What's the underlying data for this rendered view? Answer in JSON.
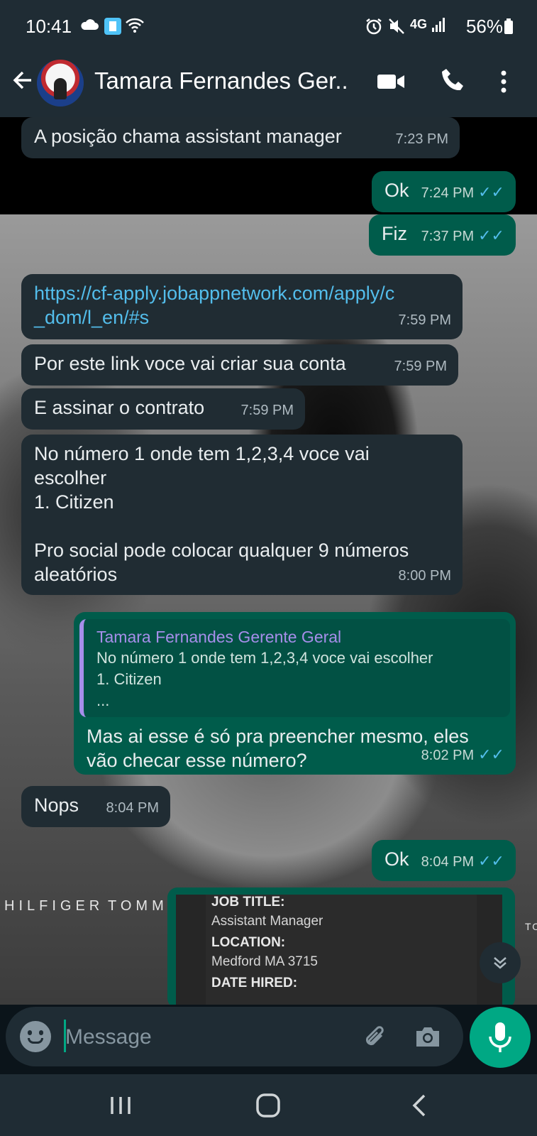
{
  "status_bar": {
    "time": "10:41",
    "network": "4G",
    "battery": "56%"
  },
  "header": {
    "contact_name": "Tamara Fernandes Ger...",
    "icons": [
      "back-arrow-icon",
      "avatar",
      "video-call-icon",
      "phone-icon",
      "more-options-icon"
    ]
  },
  "messages": [
    {
      "dir": "in",
      "text": "A posição chama assistant manager",
      "time": "7:23 PM"
    },
    {
      "dir": "out",
      "text": "Ok",
      "time": "7:24 PM",
      "read": true
    },
    {
      "dir": "out",
      "text": "Fiz",
      "time": "7:37 PM",
      "read": true
    },
    {
      "dir": "in",
      "link_line1": "https://cf-apply.jobappnetwork.com/apply/c",
      "link_line2": "_dom/l_en/#s",
      "time": "7:59 PM"
    },
    {
      "dir": "in",
      "text": "Por este link voce vai criar sua conta",
      "time": "7:59 PM"
    },
    {
      "dir": "in",
      "text": "E assinar o contrato",
      "time": "7:59 PM"
    },
    {
      "dir": "in",
      "line1": "No número 1 onde tem 1,2,3,4 voce vai",
      "line2": "escolher",
      "line3": "1. Citizen",
      "line4": "Pro social pode colocar qualquer 9 números",
      "line5": "aleatórios",
      "time": "8:00 PM"
    },
    {
      "dir": "out",
      "quote_name": "Tamara Fernandes Gerente Geral",
      "quote_line1": "No número 1 onde tem 1,2,3,4 voce vai escolher",
      "quote_line2": "1. Citizen",
      "quote_line3": "...",
      "line1": "Mas ai esse é só pra preencher mesmo, eles",
      "line2": "vão checar esse número?",
      "time": "8:02 PM",
      "read": true
    },
    {
      "dir": "in",
      "text": "Nops",
      "time": "8:04 PM"
    },
    {
      "dir": "out",
      "text": "Ok",
      "time": "8:04 PM",
      "read": true
    }
  ],
  "document_preview": {
    "job_title_label": "JOB TITLE:",
    "job_title_value": "Assistant Manager",
    "location_label": "LOCATION:",
    "location_value": "Medford MA 3715",
    "date_hired_label": "DATE HIRED:"
  },
  "wallpaper_text": {
    "brand1": "HILFIGER",
    "brand2": "TOMMY",
    "brand3": "TO"
  },
  "input": {
    "placeholder": "Message"
  },
  "colors": {
    "incoming_bubble": "#202c33",
    "outgoing_bubble": "#005c4b",
    "read_ticks": "#53bdeb",
    "accent": "#00a884",
    "quote_name": "#a68eea"
  }
}
